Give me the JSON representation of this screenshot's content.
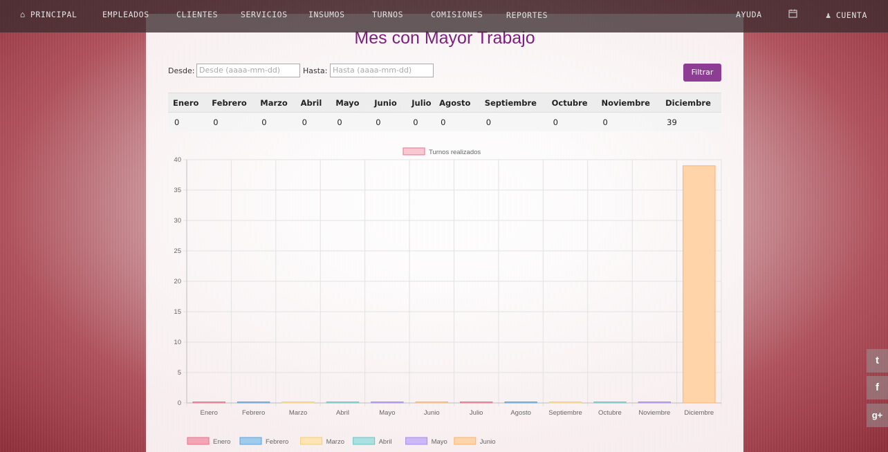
{
  "nav": {
    "items": [
      {
        "label": "PRINCIPAL",
        "icon": "home-icon"
      },
      {
        "label": "EMPLEADOS"
      },
      {
        "label": "CLIENTES"
      },
      {
        "label": "SERVICIOS"
      },
      {
        "label": "INSUMOS"
      },
      {
        "label": "TURNOS"
      },
      {
        "label": "COMISIONES"
      },
      {
        "label": "REPORTES"
      }
    ],
    "right": [
      {
        "label": "AYUDA"
      },
      {
        "label": "",
        "icon": "calendar-icon"
      },
      {
        "label": "CUENTA",
        "icon": "user-icon"
      }
    ]
  },
  "page": {
    "title": "Mes con Mayor Trabajo",
    "desde_label": "Desde:",
    "desde_placeholder": "Desde (aaaa-mm-dd)",
    "hasta_label": "Hasta:",
    "hasta_placeholder": "Hasta (aaaa-mm-dd)",
    "filter_button": "Filtrar"
  },
  "table": {
    "headers": [
      "Enero",
      "Febrero",
      "Marzo",
      "Abril",
      "Mayo",
      "Junio",
      "Julio",
      "Agosto",
      "Septiembre",
      "Octubre",
      "Noviembre",
      "Diciembre"
    ],
    "values": [
      "0",
      "0",
      "0",
      "0",
      "0",
      "0",
      "0",
      "0",
      "0",
      "0",
      "0",
      "39"
    ]
  },
  "chart_data": {
    "type": "bar",
    "title": "",
    "xlabel": "",
    "ylabel": "",
    "categories": [
      "Enero",
      "Febrero",
      "Marzo",
      "Abril",
      "Mayo",
      "Junio",
      "Julio",
      "Agosto",
      "Septiembre",
      "Octubre",
      "Noviembre",
      "Diciembre"
    ],
    "series": [
      {
        "name": "Turnos realizados",
        "values": [
          0,
          0,
          0,
          0,
          0,
          0,
          0,
          0,
          0,
          0,
          0,
          39
        ]
      }
    ],
    "ylim": [
      0,
      40
    ],
    "yticks": [
      0,
      5,
      10,
      15,
      20,
      25,
      30,
      35,
      40
    ],
    "grid": true,
    "legend_top": "top",
    "bottom_legend": [
      "Enero",
      "Febrero",
      "Marzo",
      "Abril",
      "Mayo",
      "Junio"
    ],
    "bar_colors": [
      "#f5a4b5",
      "#9fcbec",
      "#fde6b3",
      "#a9e0e0",
      "#cbb8f7",
      "#ffd4a8",
      "#f5a4b5",
      "#9fcbec",
      "#fde6b3",
      "#a9e0e0",
      "#cbb8f7",
      "#ffd4a8"
    ],
    "bar_borders": [
      "#ef6f8c",
      "#5aa5df",
      "#f8cf70",
      "#67c6c6",
      "#a88af5",
      "#ffb26b",
      "#ef6f8c",
      "#5aa5df",
      "#f8cf70",
      "#67c6c6",
      "#a88af5",
      "#ffb26b"
    ],
    "legend_color": "#f8c9d2",
    "legend_border": "#ef6f8c"
  },
  "social": [
    "t",
    "f",
    "g+"
  ]
}
